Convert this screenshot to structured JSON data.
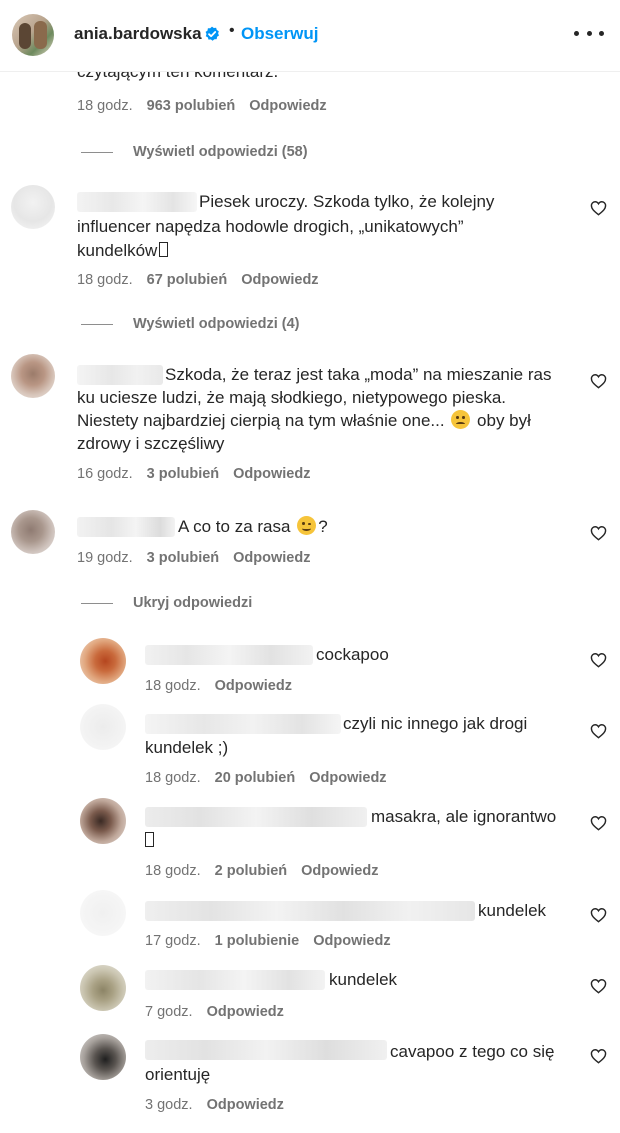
{
  "header": {
    "username": "ania.bardowska",
    "separator": "•",
    "follow_label": "Obserwuj",
    "more_icon": "more-horizontal-icon",
    "verified_icon": "verified-badge-icon",
    "accent_color": "#0095f6"
  },
  "top_comment": {
    "text_tail": "czytającym ten komentarz.",
    "time": "18 godz.",
    "likes": "963 polubień",
    "reply": "Odpowiedz",
    "view_replies": "Wyświetl odpowiedzi (58)"
  },
  "comments": [
    {
      "line1": "Piesek uroczy. Szkoda tylko, że kolejny",
      "line2": "influencer napędza hodowle drogich, „unikatowych”",
      "line3": "kundelków",
      "time": "18 godz.",
      "likes": "67 polubień",
      "reply": "Odpowiedz",
      "view_replies": "Wyświetl odpowiedzi (4)"
    },
    {
      "line1": "Szkoda, że teraz jest taka „moda” na mieszanie ras",
      "line2": "ku uciesze ludzi, że mają słodkiego, nietypowego pieska.",
      "line3": "Niestety najbardziej cierpią na tym właśnie one...",
      "line3b": "oby był",
      "line4": "zdrowy i szczęśliwy",
      "time": "16 godz.",
      "likes": "3 polubień",
      "reply": "Odpowiedz"
    },
    {
      "line1": "A co to za rasa",
      "line1b": "?",
      "time": "19 godz.",
      "likes": "3 polubień",
      "reply": "Odpowiedz",
      "hide_replies": "Ukryj odpowiedzi"
    }
  ],
  "replies": [
    {
      "line1": "cockapoo",
      "time": "18 godz.",
      "likes": "",
      "reply": "Odpowiedz"
    },
    {
      "line1": "czyli nic innego jak drogi",
      "line2": "kundelek ;)",
      "time": "18 godz.",
      "likes": "20 polubień",
      "reply": "Odpowiedz"
    },
    {
      "line1": "masakra, ale ignorantwo",
      "time": "18 godz.",
      "likes": "2 polubień",
      "reply": "Odpowiedz"
    },
    {
      "line1": "kundelek",
      "time": "17 godz.",
      "likes": "1 polubienie",
      "reply": "Odpowiedz"
    },
    {
      "line1": "kundelek",
      "time": "7 godz.",
      "likes": "",
      "reply": "Odpowiedz"
    },
    {
      "line1": "cavapoo z tego co się",
      "line2": "orientuję",
      "time": "3 godz.",
      "likes": "",
      "reply": "Odpowiedz"
    }
  ],
  "icons": {
    "like": "heart-outline-icon",
    "sad_emoji": "sad-face-emoji",
    "wink_emoji": "winking-face-emoji"
  }
}
